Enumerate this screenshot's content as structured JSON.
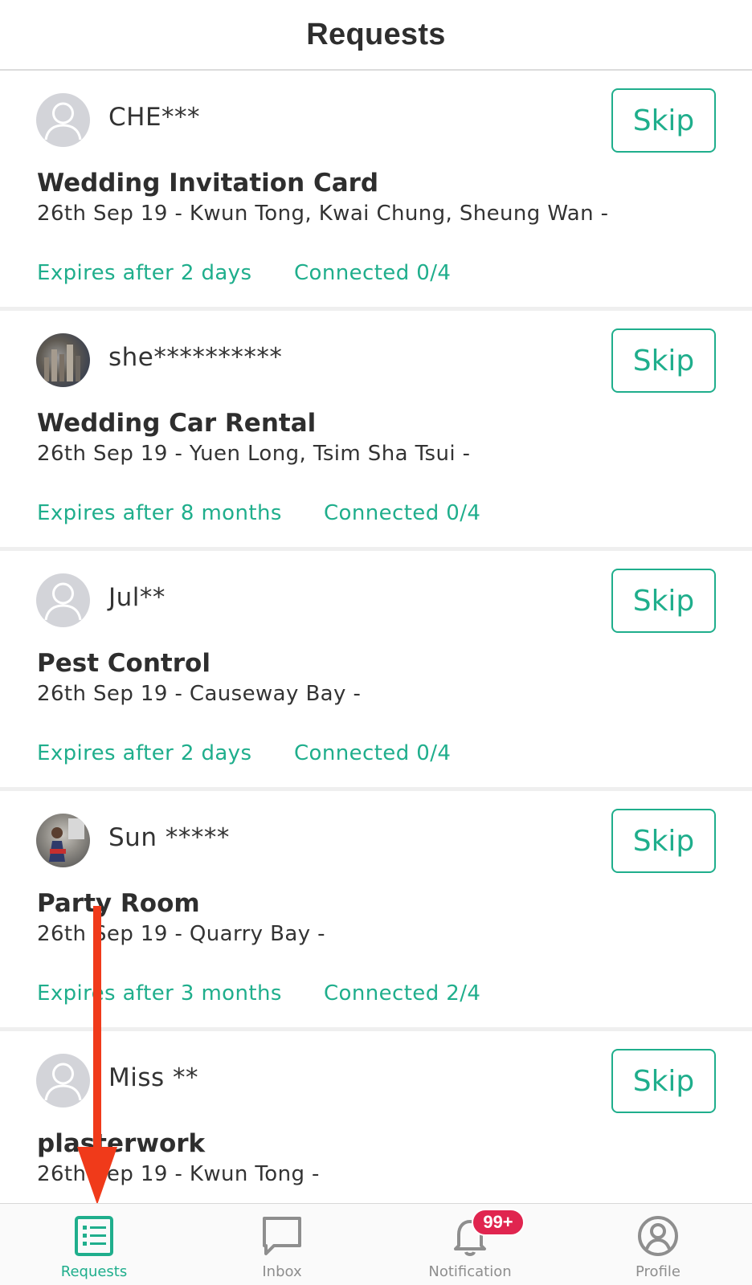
{
  "header": {
    "title": "Requests"
  },
  "requests": [
    {
      "user": "CHE***",
      "avatar": "default-avatar-icon",
      "title": "Wedding Invitation Card",
      "subtitle": "26th Sep 19 - Kwun Tong, Kwai Chung, Sheung Wan -",
      "expires": "Expires after 2 days",
      "connected": "Connected 0/4",
      "skip": "Skip"
    },
    {
      "user": "she**********",
      "avatar": "city-photo-avatar",
      "title": "Wedding Car Rental",
      "subtitle": "26th Sep 19 - Yuen Long, Tsim Sha Tsui -",
      "expires": "Expires after 8 months",
      "connected": "Connected 0/4",
      "skip": "Skip"
    },
    {
      "user": "Jul**",
      "avatar": "default-avatar-icon",
      "title": "Pest Control",
      "subtitle": "26th Sep 19 - Causeway Bay -",
      "expires": "Expires after 2 days",
      "connected": "Connected 0/4",
      "skip": "Skip"
    },
    {
      "user": "Sun *****",
      "avatar": "person-photo-avatar",
      "title": "Party Room",
      "subtitle": "26th Sep 19 - Quarry Bay -",
      "expires": "Expires after 3 months",
      "connected": "Connected 2/4",
      "skip": "Skip"
    },
    {
      "user": "Miss **",
      "avatar": "default-avatar-icon",
      "title": "plasterwork",
      "subtitle": "26th Sep 19 - Kwun Tong -",
      "expires": "",
      "connected": "",
      "skip": "Skip"
    }
  ],
  "tabbar": {
    "tabs": [
      {
        "label": "Requests",
        "icon": "list-icon",
        "active": true
      },
      {
        "label": "Inbox",
        "icon": "chat-bubble-icon",
        "active": false
      },
      {
        "label": "Notification",
        "icon": "bell-icon",
        "active": false,
        "badge": "99+"
      },
      {
        "label": "Profile",
        "icon": "user-circle-icon",
        "active": false
      }
    ]
  },
  "colors": {
    "accent": "#1fae8c",
    "badge": "#e0254f",
    "annotation_arrow": "#f03a1a",
    "inactive_tab": "#8e8e8e"
  }
}
